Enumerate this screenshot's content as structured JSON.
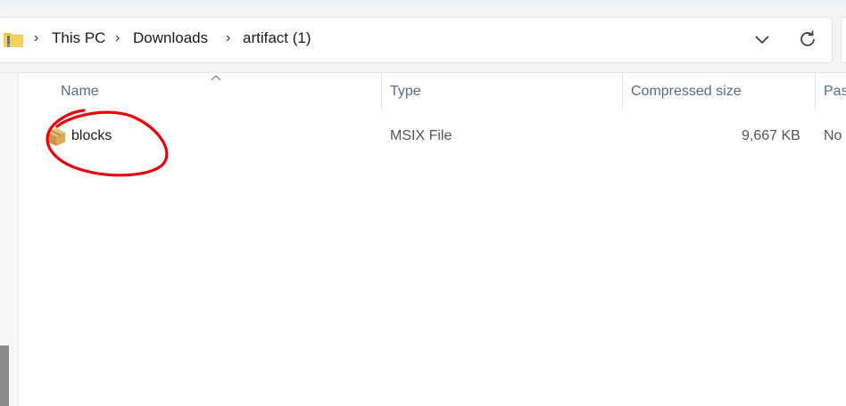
{
  "address_bar": {
    "icon": "zip-folder-icon",
    "breadcrumbs": [
      "This PC",
      "Downloads",
      "artifact (1)"
    ]
  },
  "file_list": {
    "columns": [
      "Name",
      "Type",
      "Compressed size",
      "Pas"
    ],
    "rows": [
      {
        "name": "blocks",
        "type": "MSIX File",
        "compressed_size": "9,667 KB",
        "password": "No",
        "icon": "package-icon"
      }
    ]
  },
  "annotation": {
    "shape": "red-freehand-circle",
    "target": "blocks",
    "color": "#e8000b"
  }
}
